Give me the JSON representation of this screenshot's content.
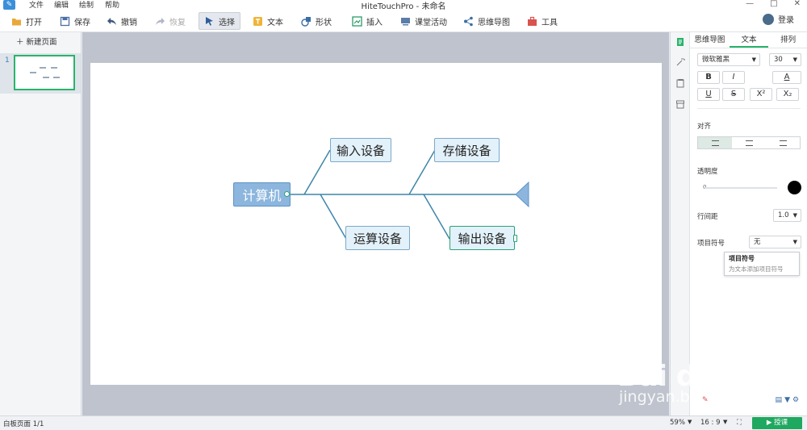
{
  "menubar": {
    "items": [
      "文件",
      "编辑",
      "绘制",
      "帮助"
    ],
    "title": "HiteTouchPro - 未命名",
    "window_controls": [
      "—",
      "□",
      "✕"
    ]
  },
  "toolbar": {
    "buttons": [
      {
        "label": "打开",
        "icon": "folder-icon"
      },
      {
        "label": "保存",
        "icon": "save-icon"
      },
      {
        "label": "撤销",
        "icon": "undo-icon"
      },
      {
        "label": "恢复",
        "icon": "redo-icon"
      },
      {
        "label": "选择",
        "icon": "cursor-icon"
      },
      {
        "label": "文本",
        "icon": "text-icon"
      },
      {
        "label": "形状",
        "icon": "shape-icon"
      },
      {
        "label": "插入",
        "icon": "insert-icon"
      },
      {
        "label": "课堂活动",
        "icon": "activity-icon"
      },
      {
        "label": "思维导图",
        "icon": "mindmap-icon"
      },
      {
        "label": "工具",
        "icon": "toolbox-icon"
      }
    ],
    "login_label": "登录"
  },
  "pages": {
    "new_page_label": "新建页面",
    "page_number": "1"
  },
  "mindmap": {
    "root": "计算机",
    "nodes": [
      "输入设备",
      "存储设备",
      "运算设备",
      "输出设备"
    ]
  },
  "properties": {
    "tabs": [
      "思维导图",
      "文本",
      "排列"
    ],
    "active_tab": "文本",
    "font_family": "微软雅黑",
    "font_size": "30",
    "format_buttons": [
      "B",
      "I",
      "A",
      "U",
      "S",
      "X²",
      "X₂"
    ],
    "align_label": "对齐",
    "opacity_label": "透明度",
    "opacity_value": "0",
    "line_spacing_label": "行间距",
    "line_spacing_value": "1.0",
    "bullet_label": "项目符号",
    "bullet_value": "无",
    "tooltip_title": "项目符号",
    "tooltip_desc": "为文本添加项目符号"
  },
  "status": {
    "page_info": "白板页面 1/1",
    "zoom": "59%",
    "ratio": "16 : 9",
    "present_label": "授课"
  },
  "watermark": {
    "main": "Bai du 经验",
    "sub": "jingyan.baidu.com"
  },
  "colors": {
    "accent": "#29b36b",
    "node_fill": "#e3f1fa",
    "root_fill": "#8cb6de",
    "line": "#3d86a8"
  }
}
